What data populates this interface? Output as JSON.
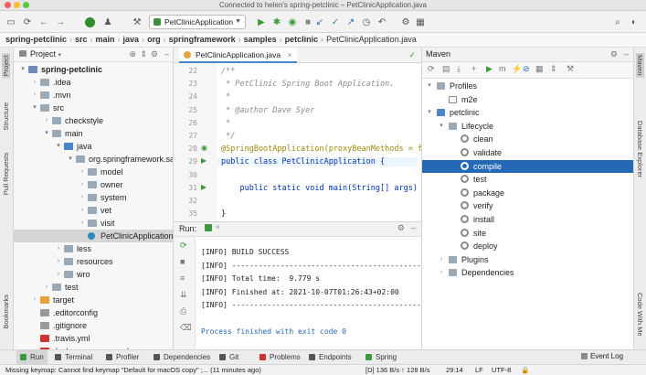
{
  "window": {
    "title": "Connected to helen's spring-petclinic – PetClinicApplication.java"
  },
  "toolbar": {
    "run_config": "PetClinicApplication"
  },
  "breadcrumbs": [
    "spring-petclinic",
    "src",
    "main",
    "java",
    "org",
    "springframework",
    "samples",
    "petclinic",
    "PetClinicApplication.java"
  ],
  "left_strip": {
    "project": "Project",
    "structure": "Structure",
    "pull_requests": "Pull Requests",
    "bookmarks": "Bookmarks"
  },
  "right_strip": {
    "maven": "Maven",
    "database": "Database Explorer",
    "code_with_me": "Code With Me"
  },
  "project": {
    "header": "Project",
    "tree": [
      {
        "label": "spring-petclinic",
        "indent": 0,
        "arrow": "▾",
        "type": "module",
        "bold": true
      },
      {
        "label": ".idea",
        "indent": 1,
        "arrow": "›",
        "type": "folder"
      },
      {
        "label": ".mvn",
        "indent": 1,
        "arrow": "›",
        "type": "folder"
      },
      {
        "label": "src",
        "indent": 1,
        "arrow": "▾",
        "type": "folder"
      },
      {
        "label": "checkstyle",
        "indent": 2,
        "arrow": "›",
        "type": "folder"
      },
      {
        "label": "main",
        "indent": 2,
        "arrow": "▾",
        "type": "folder"
      },
      {
        "label": "java",
        "indent": 3,
        "arrow": "▾",
        "type": "srcfolder"
      },
      {
        "label": "org.springframework.sa",
        "indent": 4,
        "arrow": "▾",
        "type": "package"
      },
      {
        "label": "model",
        "indent": 5,
        "arrow": "›",
        "type": "package"
      },
      {
        "label": "owner",
        "indent": 5,
        "arrow": "›",
        "type": "package"
      },
      {
        "label": "system",
        "indent": 5,
        "arrow": "›",
        "type": "package"
      },
      {
        "label": "vet",
        "indent": 5,
        "arrow": "›",
        "type": "package"
      },
      {
        "label": "visit",
        "indent": 5,
        "arrow": "›",
        "type": "package"
      },
      {
        "label": "PetClinicApplication",
        "indent": 5,
        "arrow": "",
        "type": "class",
        "selected": true
      },
      {
        "label": "less",
        "indent": 3,
        "arrow": "›",
        "type": "folder"
      },
      {
        "label": "resources",
        "indent": 3,
        "arrow": "›",
        "type": "folder"
      },
      {
        "label": "wro",
        "indent": 3,
        "arrow": "›",
        "type": "folder"
      },
      {
        "label": "test",
        "indent": 2,
        "arrow": "›",
        "type": "folder"
      },
      {
        "label": "target",
        "indent": 1,
        "arrow": "›",
        "type": "target"
      },
      {
        "label": ".editorconfig",
        "indent": 1,
        "arrow": "",
        "type": "file"
      },
      {
        "label": ".gitignore",
        "indent": 1,
        "arrow": "",
        "type": "file"
      },
      {
        "label": ".travis.yml",
        "indent": 1,
        "arrow": "",
        "type": "yml"
      },
      {
        "label": "docker-compose.yml",
        "indent": 1,
        "arrow": "",
        "type": "yml"
      }
    ]
  },
  "editor": {
    "tab": "PetClinicApplication.java",
    "lines": [
      {
        "no": "22",
        "text": "/**",
        "cls": "cmt"
      },
      {
        "no": "23",
        "text": " * PetClinic Spring Boot Application.",
        "cls": "cmt"
      },
      {
        "no": "24",
        "text": " *",
        "cls": "cmt"
      },
      {
        "no": "25",
        "text": " * @author Dave Syer",
        "cls": "cmt"
      },
      {
        "no": "26",
        "text": " *",
        "cls": "cmt"
      },
      {
        "no": "27",
        "text": " */",
        "cls": "cmt"
      },
      {
        "no": "28",
        "text": "@SpringBootApplication(proxyBeanMethods = fa",
        "cls": "an"
      },
      {
        "no": "29",
        "text": "public class PetClinicApplication {",
        "cls": "kw"
      },
      {
        "no": "30",
        "text": "",
        "cls": ""
      },
      {
        "no": "31",
        "text": "    public static void main(String[] args) {",
        "cls": "kw"
      },
      {
        "no": "32",
        "text": "",
        "cls": ""
      },
      {
        "no": "35",
        "text": "}",
        "cls": ""
      }
    ]
  },
  "run": {
    "label": "Run:",
    "lines": [
      "[INFO] BUILD SUCCESS",
      "[INFO] ------------------------------------------------",
      "[INFO] Total time:  9.779 s",
      "[INFO] Finished at: 2021-10-07T01:26:43+02:00",
      "[INFO] ------------------------------------------------",
      "",
      "Process finished with exit code 0"
    ]
  },
  "maven": {
    "header": "Maven",
    "tree": [
      {
        "label": "Profiles",
        "indent": 0,
        "arrow": "▾",
        "icon": "folder"
      },
      {
        "label": "m2e",
        "indent": 1,
        "arrow": "",
        "icon": "checkbox"
      },
      {
        "label": "petclinic",
        "indent": 0,
        "arrow": "▾",
        "icon": "maven"
      },
      {
        "label": "Lifecycle",
        "indent": 1,
        "arrow": "▾",
        "icon": "folder"
      },
      {
        "label": "clean",
        "indent": 2,
        "arrow": "",
        "icon": "gear"
      },
      {
        "label": "validate",
        "indent": 2,
        "arrow": "",
        "icon": "gear"
      },
      {
        "label": "compile",
        "indent": 2,
        "arrow": "",
        "icon": "gear",
        "selected": true
      },
      {
        "label": "test",
        "indent": 2,
        "arrow": "",
        "icon": "gear"
      },
      {
        "label": "package",
        "indent": 2,
        "arrow": "",
        "icon": "gear"
      },
      {
        "label": "verify",
        "indent": 2,
        "arrow": "",
        "icon": "gear"
      },
      {
        "label": "install",
        "indent": 2,
        "arrow": "",
        "icon": "gear"
      },
      {
        "label": "site",
        "indent": 2,
        "arrow": "",
        "icon": "gear"
      },
      {
        "label": "deploy",
        "indent": 2,
        "arrow": "",
        "icon": "gear"
      },
      {
        "label": "Plugins",
        "indent": 1,
        "arrow": "›",
        "icon": "folder"
      },
      {
        "label": "Dependencies",
        "indent": 1,
        "arrow": "›",
        "icon": "folder"
      }
    ]
  },
  "bottom_tabs": [
    "Run",
    "Terminal",
    "Profiler",
    "Dependencies",
    "Git",
    "Problems",
    "Endpoints",
    "Spring"
  ],
  "status": {
    "message": "Missing keymap: Cannot find keymap \"Default for macOS copy\" ;... (11 minutes ago)",
    "mem": "[D] 136 B/s ↑ 128 B/s",
    "pos": "29:14",
    "lf": "LF",
    "enc": "UTF-8",
    "event_log": "Event Log"
  },
  "colors": {
    "accent": "#2468b8",
    "run_green": "#3c9a3c",
    "selection": "#2468b8"
  }
}
